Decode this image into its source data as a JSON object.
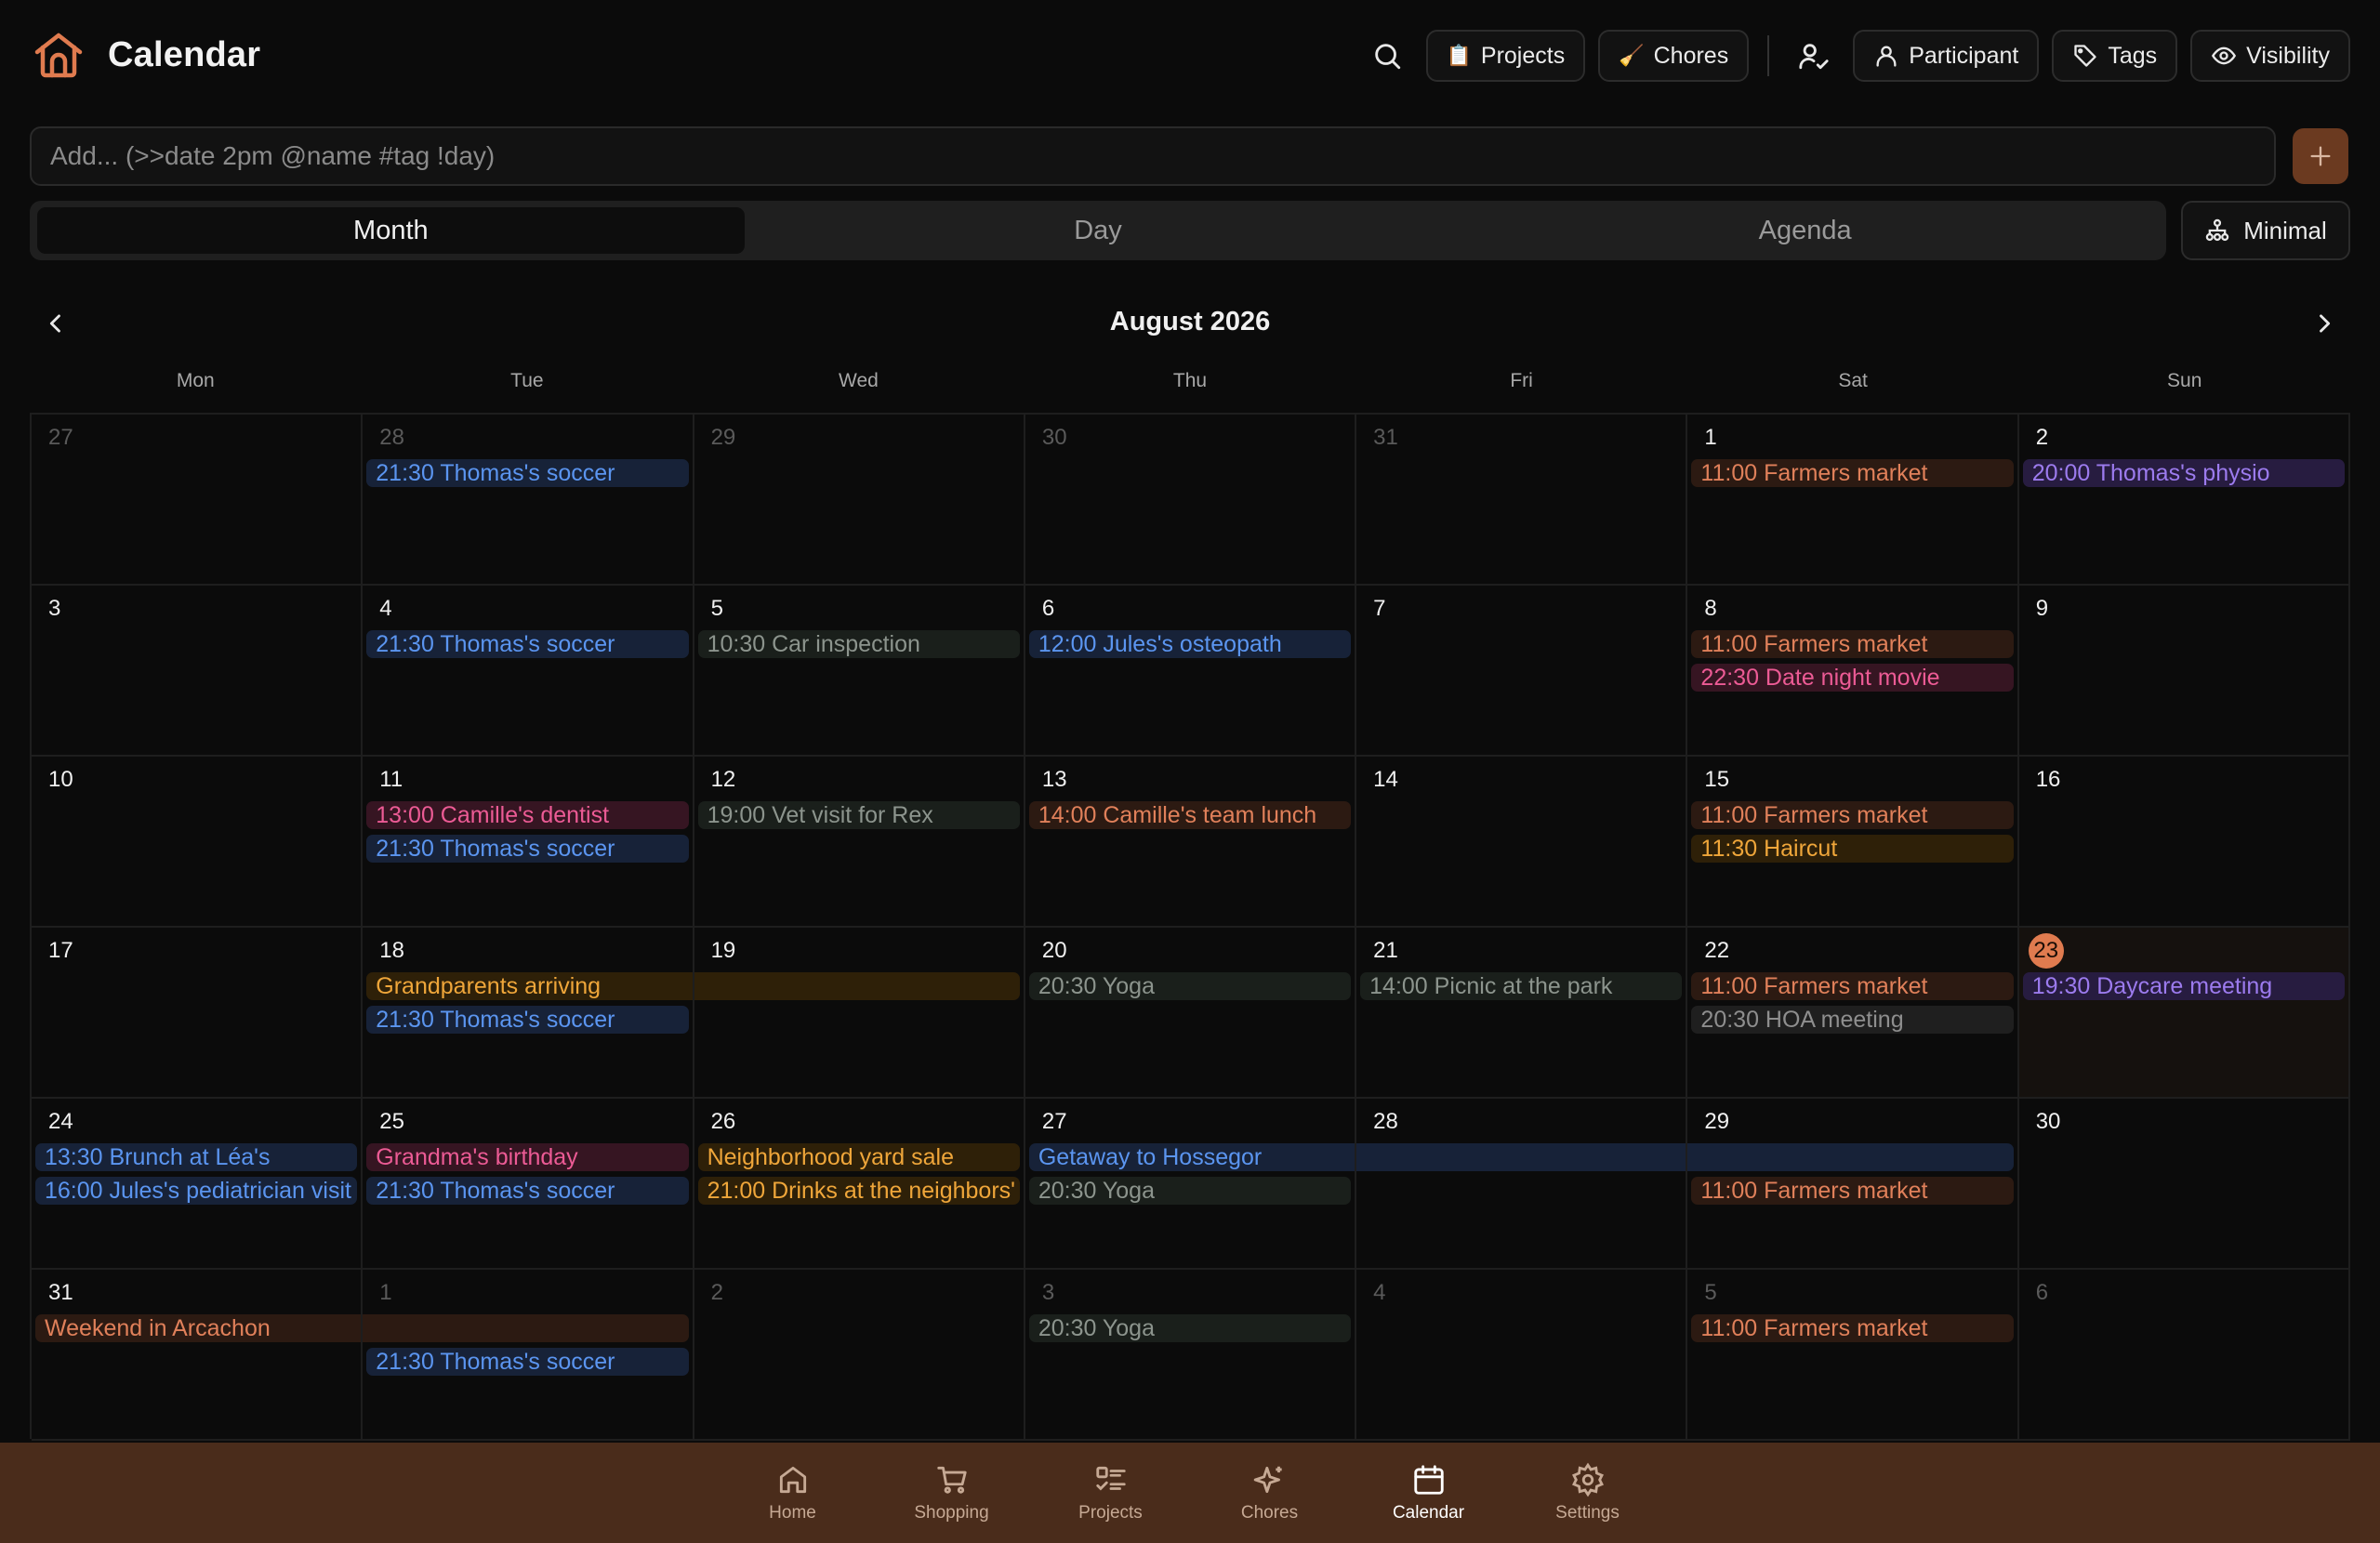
{
  "app": {
    "title": "Calendar"
  },
  "header": {
    "projects_label": "Projects",
    "projects_emoji": "📋",
    "chores_label": "Chores",
    "chores_emoji": "🧹",
    "participant_label": "Participant",
    "tags_label": "Tags",
    "visibility_label": "Visibility"
  },
  "add": {
    "placeholder": "Add... (>>date 2pm @name #tag !day)"
  },
  "views": {
    "month": "Month",
    "day": "Day",
    "agenda": "Agenda",
    "active": "Month",
    "minimal_label": "Minimal"
  },
  "calendar": {
    "title": "August 2026",
    "weekdays": [
      "Mon",
      "Tue",
      "Wed",
      "Thu",
      "Fri",
      "Sat",
      "Sun"
    ],
    "today": "23",
    "weeks": [
      [
        {
          "day": "27",
          "other": true,
          "events": []
        },
        {
          "day": "28",
          "other": true,
          "events": [
            {
              "label": "21:30 Thomas's soccer",
              "color": "blue"
            }
          ]
        },
        {
          "day": "29",
          "other": true,
          "events": []
        },
        {
          "day": "30",
          "other": true,
          "events": []
        },
        {
          "day": "31",
          "other": true,
          "events": []
        },
        {
          "day": "1",
          "events": [
            {
              "label": "11:00 Farmers market",
              "color": "orange"
            }
          ]
        },
        {
          "day": "2",
          "events": [
            {
              "label": "20:00 Thomas's physio",
              "color": "purple"
            }
          ]
        }
      ],
      [
        {
          "day": "3",
          "events": []
        },
        {
          "day": "4",
          "events": [
            {
              "label": "21:30 Thomas's soccer",
              "color": "blue"
            }
          ]
        },
        {
          "day": "5",
          "events": [
            {
              "label": "10:30 Car inspection",
              "color": "gray"
            }
          ]
        },
        {
          "day": "6",
          "events": [
            {
              "label": "12:00 Jules's osteopath",
              "color": "blue"
            }
          ]
        },
        {
          "day": "7",
          "events": []
        },
        {
          "day": "8",
          "events": [
            {
              "label": "11:00 Farmers market",
              "color": "orange"
            },
            {
              "label": "22:30 Date night movie",
              "color": "pink"
            }
          ]
        },
        {
          "day": "9",
          "events": []
        }
      ],
      [
        {
          "day": "10",
          "events": []
        },
        {
          "day": "11",
          "events": [
            {
              "label": "13:00 Camille's dentist",
              "color": "pink"
            },
            {
              "label": "21:30 Thomas's soccer",
              "color": "blue"
            }
          ]
        },
        {
          "day": "12",
          "events": [
            {
              "label": "19:00 Vet visit for Rex",
              "color": "gray"
            }
          ]
        },
        {
          "day": "13",
          "events": [
            {
              "label": "14:00 Camille's team lunch",
              "color": "orange"
            }
          ]
        },
        {
          "day": "14",
          "events": []
        },
        {
          "day": "15",
          "events": [
            {
              "label": "11:00 Farmers market",
              "color": "orange"
            },
            {
              "label": "11:30 Haircut",
              "color": "amber"
            }
          ]
        },
        {
          "day": "16",
          "events": []
        }
      ],
      [
        {
          "day": "17",
          "events": []
        },
        {
          "day": "18",
          "events": [
            {
              "label": "Grandparents arriving",
              "color": "amber",
              "span": "start"
            },
            {
              "label": "21:30 Thomas's soccer",
              "color": "blue"
            }
          ]
        },
        {
          "day": "19",
          "events": [
            {
              "label": "",
              "color": "amber",
              "span": "end"
            }
          ]
        },
        {
          "day": "20",
          "events": [
            {
              "label": "20:30 Yoga",
              "color": "gray"
            }
          ]
        },
        {
          "day": "21",
          "events": [
            {
              "label": "14:00 Picnic at the park",
              "color": "gray"
            }
          ]
        },
        {
          "day": "22",
          "events": [
            {
              "label": "11:00 Farmers market",
              "color": "orange"
            },
            {
              "label": "20:30 HOA meeting",
              "color": "slate"
            }
          ]
        },
        {
          "day": "23",
          "today": true,
          "events": [
            {
              "label": "19:30 Daycare meeting",
              "color": "purple"
            }
          ]
        }
      ],
      [
        {
          "day": "24",
          "events": [
            {
              "label": "13:30 Brunch at Léa's",
              "color": "blue"
            },
            {
              "label": "16:00 Jules's pediatrician visit",
              "color": "blue"
            }
          ]
        },
        {
          "day": "25",
          "events": [
            {
              "label": "Grandma's birthday",
              "color": "pink"
            },
            {
              "label": "21:30 Thomas's soccer",
              "color": "blue"
            }
          ]
        },
        {
          "day": "26",
          "events": [
            {
              "label": "Neighborhood yard sale",
              "color": "amber"
            },
            {
              "label": "21:00 Drinks at the neighbors'",
              "color": "amber"
            }
          ]
        },
        {
          "day": "27",
          "events": [
            {
              "label": "Getaway to Hossegor",
              "color": "blue",
              "span": "start"
            },
            {
              "label": "20:30 Yoga",
              "color": "gray"
            }
          ]
        },
        {
          "day": "28",
          "events": [
            {
              "label": "",
              "color": "blue",
              "span": "cont"
            }
          ]
        },
        {
          "day": "29",
          "events": [
            {
              "label": "",
              "color": "blue",
              "span": "end"
            },
            {
              "label": "11:00 Farmers market",
              "color": "orange"
            }
          ]
        },
        {
          "day": "30",
          "events": []
        }
      ],
      [
        {
          "day": "31",
          "events": [
            {
              "label": "Weekend in Arcachon",
              "color": "orange",
              "span": "start"
            }
          ]
        },
        {
          "day": "1",
          "other": true,
          "events": [
            {
              "label": "",
              "color": "orange",
              "span": "end"
            },
            {
              "label": "21:30 Thomas's soccer",
              "color": "blue"
            }
          ]
        },
        {
          "day": "2",
          "other": true,
          "events": []
        },
        {
          "day": "3",
          "other": true,
          "events": [
            {
              "label": "20:30 Yoga",
              "color": "gray"
            }
          ]
        },
        {
          "day": "4",
          "other": true,
          "events": []
        },
        {
          "day": "5",
          "other": true,
          "events": [
            {
              "label": "11:00 Farmers market",
              "color": "orange"
            }
          ]
        },
        {
          "day": "6",
          "other": true,
          "events": []
        }
      ]
    ]
  },
  "bottom_nav": [
    {
      "label": "Home",
      "icon": "home-icon"
    },
    {
      "label": "Shopping",
      "icon": "cart-icon"
    },
    {
      "label": "Projects",
      "icon": "list-icon"
    },
    {
      "label": "Chores",
      "icon": "sparkle-icon"
    },
    {
      "label": "Calendar",
      "icon": "calendar-icon",
      "active": true
    },
    {
      "label": "Settings",
      "icon": "gear-icon"
    }
  ],
  "colors": {
    "accent": "#e07b4f",
    "bottom_bar": "#4a2c1b",
    "add_button": "#6b3a20"
  }
}
